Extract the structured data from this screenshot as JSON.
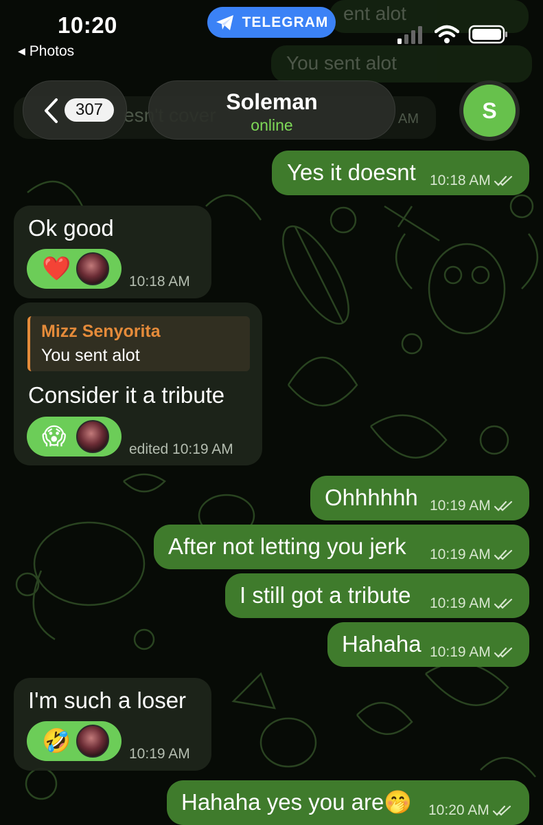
{
  "status_bar": {
    "time": "10:20",
    "back_app": "Photos",
    "telegram_pill": "TELEGRAM",
    "icons": [
      "signal-icon",
      "wifi-icon",
      "battery-icon"
    ]
  },
  "header": {
    "unread_count": "307",
    "contact_name": "Soleman",
    "contact_status": "online",
    "avatar_initial": "S"
  },
  "background_ghosts": {
    "top_1": "ent alot",
    "top_2": "You sent alot",
    "behind_header": "esn't cover",
    "behind_header_time": "AM"
  },
  "messages": [
    {
      "dir": "out",
      "text": "Yes it doesnt",
      "time": "10:18 AM",
      "read": true
    },
    {
      "dir": "in",
      "text": "Ok good",
      "time": "10:18 AM",
      "reaction": "❤️"
    },
    {
      "dir": "in",
      "reply_to": {
        "name": "Mizz Senyorita",
        "text": "You sent alot"
      },
      "text": "Consider it a tribute",
      "time": "edited 10:19 AM",
      "reaction": "😱"
    },
    {
      "dir": "out",
      "text": "Ohhhhhh",
      "time": "10:19 AM",
      "read": true
    },
    {
      "dir": "out",
      "text": "After not letting you jerk",
      "time": "10:19 AM",
      "read": true
    },
    {
      "dir": "out",
      "text": "I still got a tribute",
      "time": "10:19 AM",
      "read": true
    },
    {
      "dir": "out",
      "text": "Hahaha",
      "time": "10:19 AM",
      "read": true
    },
    {
      "dir": "in",
      "text": "I'm such a loser",
      "time": "10:19 AM",
      "reaction": "🤣"
    },
    {
      "dir": "out",
      "text": "Hahaha yes you are🤭",
      "time": "10:20 AM",
      "read": true
    }
  ],
  "colors": {
    "outgoing_bubble": "#3f7b2c",
    "incoming_bubble": "#1e261b",
    "reaction_pill": "#6ccd58",
    "online_green": "#7ed957",
    "telegram_blue": "#3b82f6",
    "reply_accent": "#e58b3a"
  }
}
